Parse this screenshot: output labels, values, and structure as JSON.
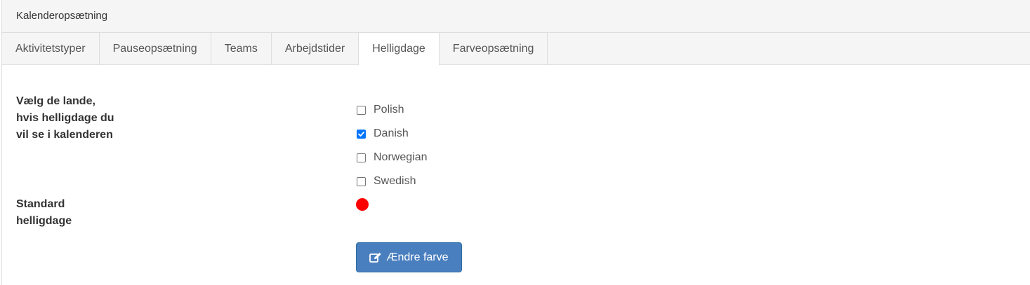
{
  "panel": {
    "title": "Kalenderopsætning"
  },
  "tabs": [
    {
      "label": "Aktivitetstyper",
      "active": false
    },
    {
      "label": "Pauseopsætning",
      "active": false
    },
    {
      "label": "Teams",
      "active": false
    },
    {
      "label": "Arbejdstider",
      "active": false
    },
    {
      "label": "Helligdage",
      "active": true
    },
    {
      "label": "Farveopsætning",
      "active": false
    }
  ],
  "countries": {
    "label_lines": [
      "Vælg de lande,",
      "hvis helligdage du",
      "vil se i kalenderen"
    ],
    "options": [
      {
        "label": "Polish",
        "checked": false
      },
      {
        "label": "Danish",
        "checked": true
      },
      {
        "label": "Norwegian",
        "checked": false
      },
      {
        "label": "Swedish",
        "checked": false
      }
    ]
  },
  "standard": {
    "label_lines": [
      "Standard",
      "helligdage"
    ],
    "color": "#ff0000"
  },
  "change_color_button": {
    "label": "Ændre farve",
    "icon": "edit-icon",
    "color": "#4a7fbf"
  }
}
